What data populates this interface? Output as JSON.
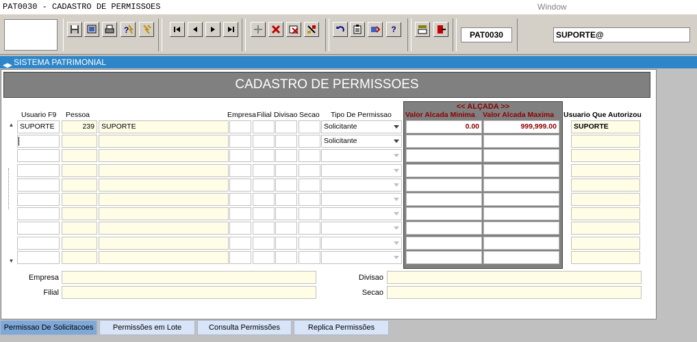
{
  "window": {
    "title": "PAT0030 - CADASTRO DE PERMISSOES",
    "menu": "Window"
  },
  "toolbar": {
    "program_code": "PAT0030",
    "user": "SUPORTE@",
    "icons": [
      "save-icon",
      "preview-icon",
      "print-icon",
      "help-query-icon",
      "execute-query-icon",
      "first-record-icon",
      "previous-record-icon",
      "next-record-icon",
      "last-record-icon",
      "insert-record-icon",
      "delete-record-icon",
      "clear-record-icon",
      "clear-form-icon",
      "undo-icon",
      "paste-icon",
      "tools-icon",
      "help-icon",
      "menu-icon",
      "exit-icon"
    ],
    "help_label": "?"
  },
  "system_bar": {
    "label": "SISTEMA PATRIMONIAL"
  },
  "form": {
    "title": "CADASTRO DE PERMISSOES",
    "columns": {
      "usuario": "Usuario F9",
      "pessoa": "Pessoa",
      "empresa": "Empresa",
      "filial": "Filial",
      "divisao": "Divisao",
      "secao": "Secao",
      "tipo": "Tipo De Permissao",
      "alcada_title": "<< ALÇADA >>",
      "valor_min": "Valor Alcada Minima",
      "valor_max": "Valor Alcada Maxima",
      "autorizou": "Usuario Que Autorizou"
    },
    "rows": [
      {
        "usuario": "SUPORTE",
        "pessoa_id": "239",
        "pessoa_nome": "SUPORTE",
        "empresa": "",
        "filial": "",
        "divisao": "",
        "secao": "",
        "tipo": "Solicitante",
        "valor_min": "0.00",
        "valor_max": "999,999.00",
        "autorizou": "SUPORTE"
      },
      {
        "usuario": "",
        "pessoa_id": "",
        "pessoa_nome": "",
        "empresa": "",
        "filial": "",
        "divisao": "",
        "secao": "",
        "tipo": "Solicitante",
        "valor_min": "",
        "valor_max": "",
        "autorizou": ""
      },
      {
        "usuario": "",
        "pessoa_id": "",
        "pessoa_nome": "",
        "empresa": "",
        "filial": "",
        "divisao": "",
        "secao": "",
        "tipo": "",
        "valor_min": "",
        "valor_max": "",
        "autorizou": ""
      },
      {
        "usuario": "",
        "pessoa_id": "",
        "pessoa_nome": "",
        "empresa": "",
        "filial": "",
        "divisao": "",
        "secao": "",
        "tipo": "",
        "valor_min": "",
        "valor_max": "",
        "autorizou": ""
      },
      {
        "usuario": "",
        "pessoa_id": "",
        "pessoa_nome": "",
        "empresa": "",
        "filial": "",
        "divisao": "",
        "secao": "",
        "tipo": "",
        "valor_min": "",
        "valor_max": "",
        "autorizou": ""
      },
      {
        "usuario": "",
        "pessoa_id": "",
        "pessoa_nome": "",
        "empresa": "",
        "filial": "",
        "divisao": "",
        "secao": "",
        "tipo": "",
        "valor_min": "",
        "valor_max": "",
        "autorizou": ""
      },
      {
        "usuario": "",
        "pessoa_id": "",
        "pessoa_nome": "",
        "empresa": "",
        "filial": "",
        "divisao": "",
        "secao": "",
        "tipo": "",
        "valor_min": "",
        "valor_max": "",
        "autorizou": ""
      },
      {
        "usuario": "",
        "pessoa_id": "",
        "pessoa_nome": "",
        "empresa": "",
        "filial": "",
        "divisao": "",
        "secao": "",
        "tipo": "",
        "valor_min": "",
        "valor_max": "",
        "autorizou": ""
      },
      {
        "usuario": "",
        "pessoa_id": "",
        "pessoa_nome": "",
        "empresa": "",
        "filial": "",
        "divisao": "",
        "secao": "",
        "tipo": "",
        "valor_min": "",
        "valor_max": "",
        "autorizou": ""
      },
      {
        "usuario": "",
        "pessoa_id": "",
        "pessoa_nome": "",
        "empresa": "",
        "filial": "",
        "divisao": "",
        "secao": "",
        "tipo": "",
        "valor_min": "",
        "valor_max": "",
        "autorizou": ""
      }
    ],
    "details": {
      "empresa_label": "Empresa",
      "empresa_value": "",
      "filial_label": "Filial",
      "filial_value": "",
      "divisao_label": "Divisao",
      "divisao_value": "",
      "secao_label": "Secao",
      "secao_value": ""
    }
  },
  "tabs": [
    {
      "label": "Permissao De Solicitacoes",
      "active": true
    },
    {
      "label": "Permissões em Lote",
      "active": false
    },
    {
      "label": "Consulta Permissões",
      "active": false
    },
    {
      "label": "Replica Permissões",
      "active": false
    }
  ]
}
